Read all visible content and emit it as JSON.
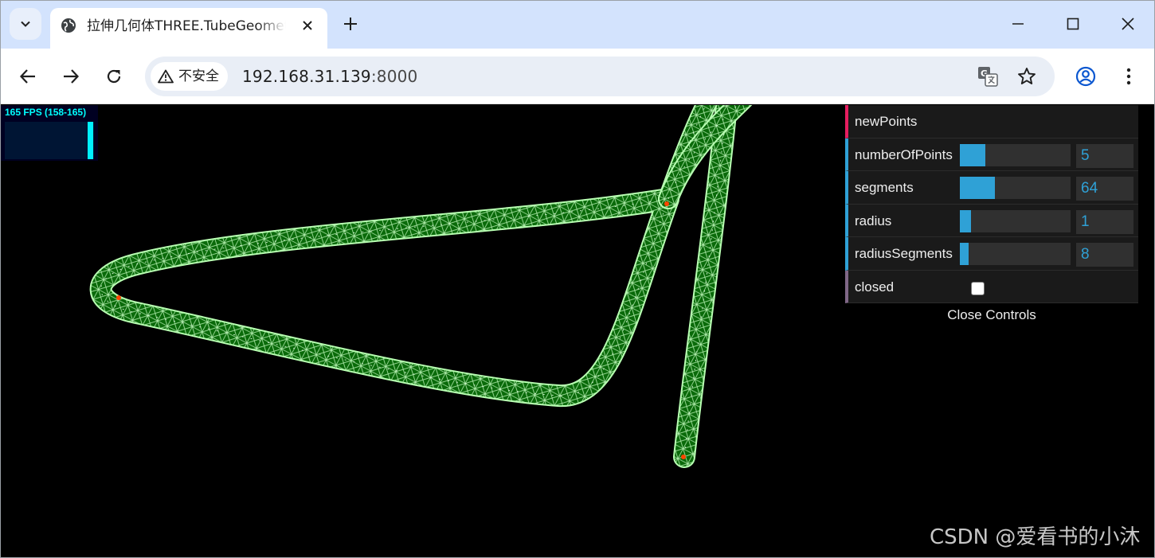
{
  "browser": {
    "tab_title": "拉伸几何体THREE.TubeGeometry",
    "security_label": "不安全",
    "url_host": "192.168.31.139",
    "url_port": ":8000",
    "icons": {
      "tab_search": "chevron-down-icon",
      "favicon": "globe-icon",
      "close": "close-icon",
      "new_tab": "plus-icon",
      "minimize": "minimize-icon",
      "maximize": "maximize-icon",
      "back": "arrow-left-icon",
      "forward": "arrow-right-icon",
      "reload": "reload-icon",
      "warning": "warning-icon",
      "translate": "translate-icon",
      "bookmark": "star-icon",
      "profile": "profile-icon",
      "menu": "kebab-menu-icon"
    }
  },
  "stats": {
    "fps_text": "165 FPS (158-165)",
    "color": "#00ffff"
  },
  "gui": {
    "controls": [
      {
        "label": "newPoints",
        "type": "function"
      },
      {
        "label": "numberOfPoints",
        "type": "number",
        "value": "5",
        "fill": 0.23
      },
      {
        "label": "segments",
        "type": "number",
        "value": "64",
        "fill": 0.32
      },
      {
        "label": "radius",
        "type": "number",
        "value": "1",
        "fill": 0.1
      },
      {
        "label": "radiusSegments",
        "type": "number",
        "value": "8",
        "fill": 0.08
      },
      {
        "label": "closed",
        "type": "boolean",
        "checked": false
      }
    ],
    "close_label": "Close Controls",
    "accent_color": "#2fa1d6"
  },
  "scene": {
    "mesh_color": "#00ff00",
    "wireframe_color": "#ffffff",
    "point_color": "#ff4500"
  },
  "watermark": "CSDN @爱看书的小沐"
}
